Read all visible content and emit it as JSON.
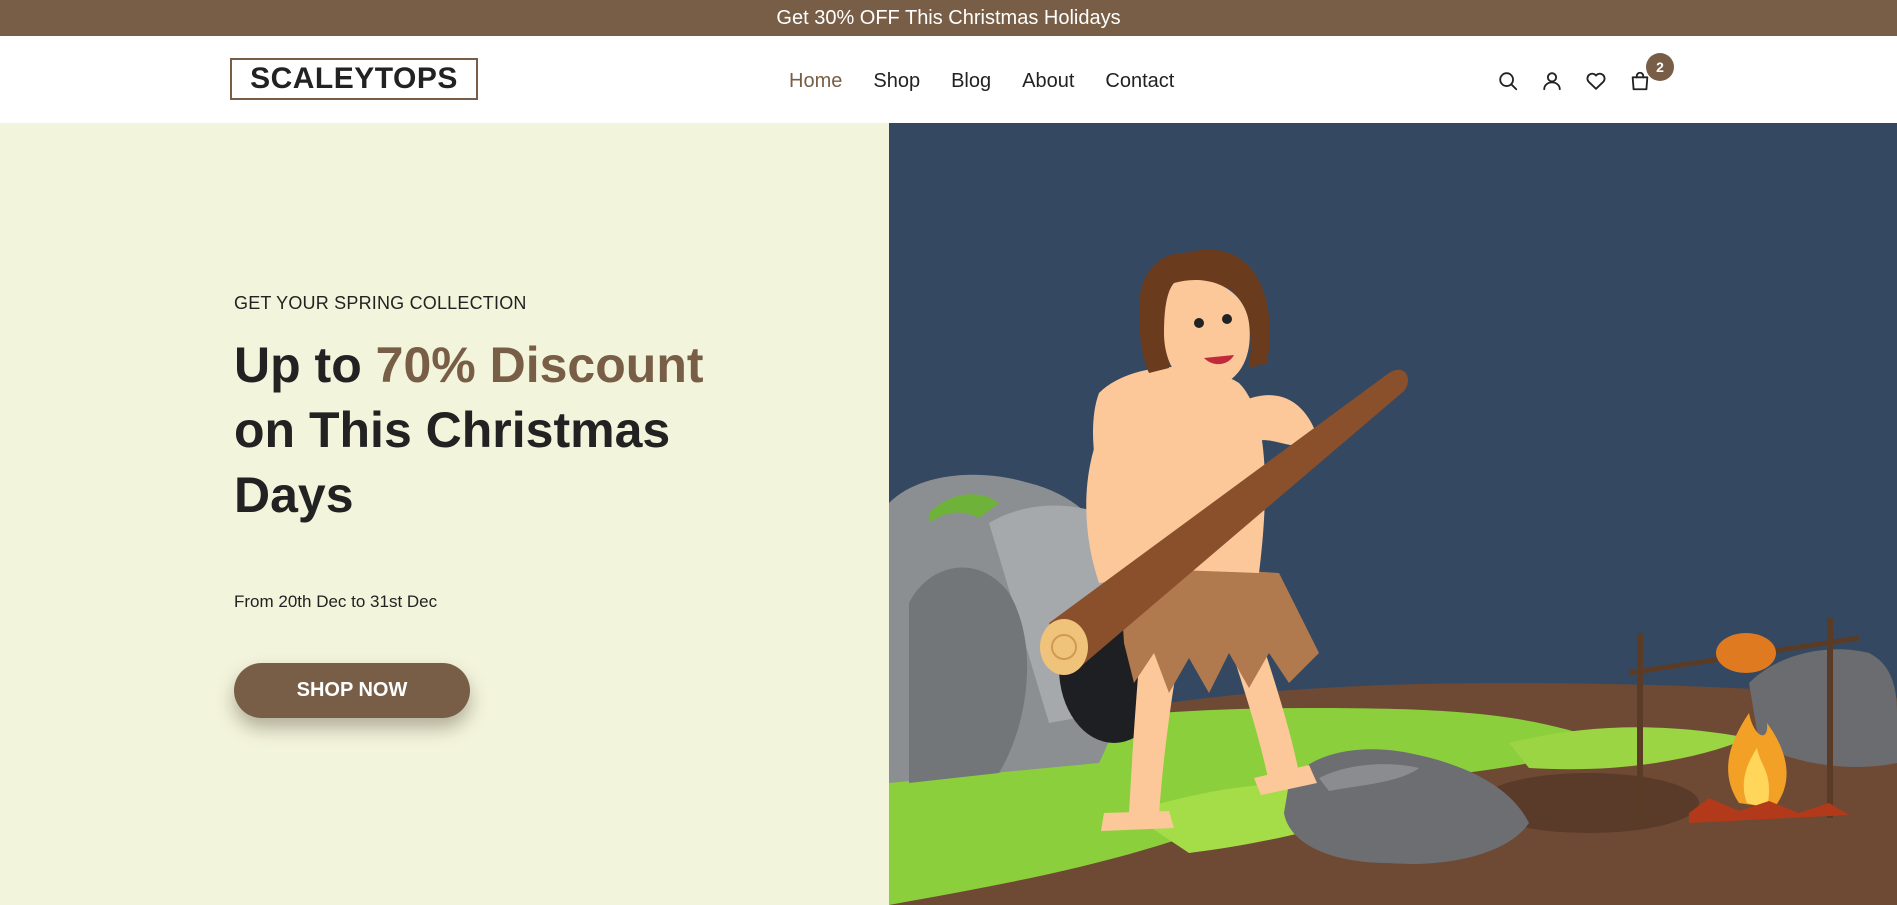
{
  "promo": {
    "text": "Get 30% OFF This Christmas Holidays"
  },
  "header": {
    "logo": "SCALEYTOPS",
    "nav": [
      {
        "label": "Home",
        "active": true
      },
      {
        "label": "Shop",
        "active": false
      },
      {
        "label": "Blog",
        "active": false
      },
      {
        "label": "About",
        "active": false
      },
      {
        "label": "Contact",
        "active": false
      }
    ],
    "icons": [
      "search-icon",
      "user-icon",
      "heart-icon",
      "shopping-bag-icon"
    ],
    "cart_count": "2"
  },
  "hero": {
    "eyebrow": "GET YOUR SPRING COLLECTION",
    "headline": {
      "part1": "Up to ",
      "accent1": "70%",
      "accent2": "Discount",
      "part2": " on This Christmas Days"
    },
    "dates": "From 20th Dec to 31st Dec",
    "cta": "SHOP NOW",
    "image": "caveman-illustration"
  },
  "colors": {
    "brand": "#785e46",
    "hero_bg": "#f3f4dc",
    "illustration_bg": "#344961",
    "text": "#222222"
  }
}
